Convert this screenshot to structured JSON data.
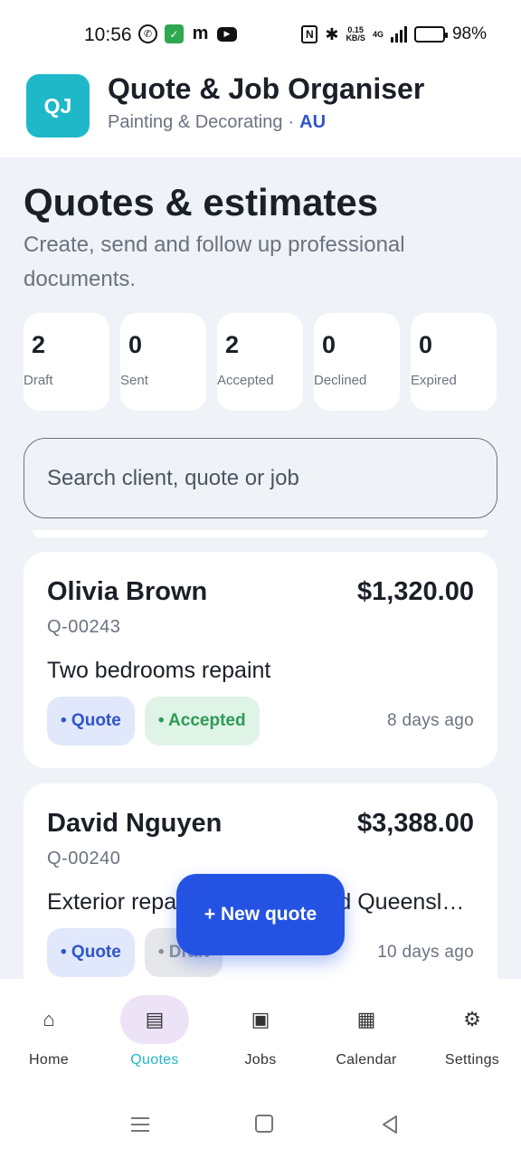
{
  "status_bar": {
    "time": "10:56",
    "network_speed_value": "0.15",
    "network_speed_unit": "KB/S",
    "network_type": "4G",
    "battery": "98%",
    "battery_level": 0.98,
    "icons": [
      "viber-icon",
      "shield-icon",
      "m-icon",
      "youtube-icon",
      "nfc-icon",
      "bluetooth-icon",
      "signal-icon",
      "battery-icon"
    ]
  },
  "header": {
    "logo_text": "QJ",
    "title": "Quote & Job Organiser",
    "subtitle": "Painting & Decorating",
    "separator": "·",
    "region": "AU"
  },
  "page": {
    "title": "Quotes & estimates",
    "description": "Create, send and follow up professional documents."
  },
  "stats": [
    {
      "count": "2",
      "label": "Draft"
    },
    {
      "count": "0",
      "label": "Sent"
    },
    {
      "count": "2",
      "label": "Accepted"
    },
    {
      "count": "0",
      "label": "Declined"
    },
    {
      "count": "0",
      "label": "Expired"
    }
  ],
  "search": {
    "placeholder": "Search client, quote or job"
  },
  "quotes": [
    {
      "client": "Olivia Brown",
      "amount": "$1,320.00",
      "number": "Q-00243",
      "job": "Two bedrooms repaint",
      "type_pill": "• Quote",
      "status_pill": "• Accepted",
      "age": "8 days ago"
    },
    {
      "client": "David Nguyen",
      "amount": "$3,388.00",
      "number": "Q-00240",
      "job": "Exterior repaint, weatherboard Queensland home",
      "type_pill": "• Quote",
      "status_pill": "• Draft",
      "age": "10 days ago"
    }
  ],
  "fab": {
    "label": "+ New quote"
  },
  "bottom_nav": [
    {
      "label": "Home",
      "icon": "home-icon",
      "glyph": "⌂"
    },
    {
      "label": "Quotes",
      "icon": "document-list-icon",
      "glyph": "▤"
    },
    {
      "label": "Jobs",
      "icon": "jobs-square-icon",
      "glyph": "▣"
    },
    {
      "label": "Calendar",
      "icon": "calendar-grid-icon",
      "glyph": "▦"
    },
    {
      "label": "Settings",
      "icon": "gear-icon",
      "glyph": "⚙"
    }
  ],
  "colors": {
    "accent": "#1fb8c9",
    "primary_button": "#2453e3",
    "region_text": "#2f55c9",
    "accepted": "#2e9b55",
    "background": "#eff3f7"
  }
}
